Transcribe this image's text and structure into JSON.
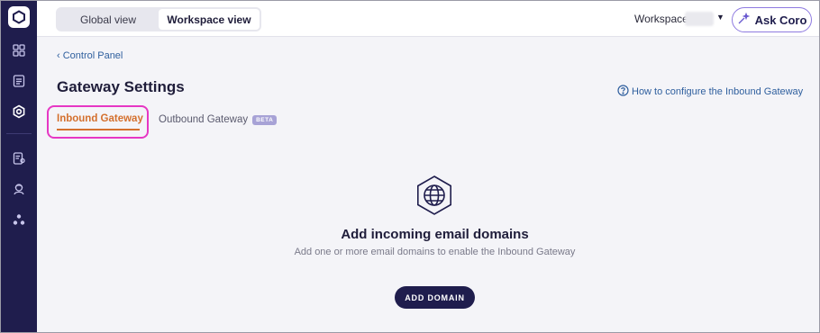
{
  "sidebar": {
    "logo": "coro-logo-icon",
    "items": [
      {
        "icon": "dashboard-grid-icon"
      },
      {
        "icon": "list-document-icon"
      },
      {
        "icon": "settings-gear-icon",
        "active": true
      },
      {
        "icon": "report-document-icon"
      },
      {
        "icon": "support-agent-icon"
      },
      {
        "icon": "network-nodes-icon"
      }
    ]
  },
  "topbar": {
    "view_toggle": {
      "global_label": "Global view",
      "workspace_label": "Workspace view",
      "active": "workspace"
    },
    "workspace_label": "Workspace:",
    "ask_coro_label": "Ask Coro"
  },
  "main": {
    "breadcrumb": "‹ Control Panel",
    "title": "Gateway Settings",
    "help_link": "How to configure the Inbound Gateway",
    "tabs": [
      {
        "label": "Inbound Gateway",
        "active": true
      },
      {
        "label": "Outbound Gateway",
        "badge": "BETA"
      }
    ],
    "empty_state": {
      "icon": "globe-icon",
      "title": "Add incoming email domains",
      "description": "Add one or more email domains to enable the Inbound Gateway",
      "button_label": "ADD DOMAIN"
    }
  },
  "colors": {
    "sidebar_bg": "#1f1d4d",
    "accent_orange": "#d4702e",
    "highlight_pink": "#e637c4",
    "link_blue": "#2f5f9e",
    "primary_button": "#1f1d4d"
  }
}
